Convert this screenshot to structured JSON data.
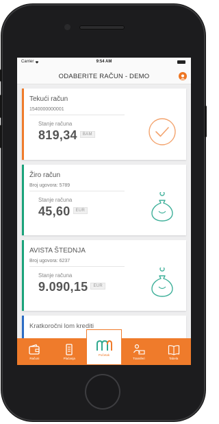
{
  "status_bar": {
    "carrier": "Carrier",
    "time": "9:54 AM"
  },
  "header": {
    "title": "ODABERITE RAČUN - DEMO"
  },
  "accounts": [
    {
      "name": "Tekući račun",
      "subtitle": "1540000000001",
      "balance_label": "Stanje računa",
      "balance": "819,34",
      "currency": "BAM",
      "accent_color": "#ef7b2b",
      "icon": "checkmark-circle-icon",
      "icon_color": "#f3a36d"
    },
    {
      "name": "Žiro račun",
      "subtitle": "Broj ugovora: 5789",
      "balance_label": "Stanje računa",
      "balance": "45,60",
      "currency": "EUR",
      "accent_color": "#1aa37a",
      "icon": "piggy-bank-icon",
      "icon_color": "#3fb09a"
    },
    {
      "name": "AVISTA ŠTEDNJA",
      "subtitle": "Broj ugovora: 6237",
      "balance_label": "Stanje računa",
      "balance": "9.090,15",
      "currency": "EUR",
      "accent_color": "#1aa37a",
      "icon": "piggy-bank-icon",
      "icon_color": "#3fb09a"
    },
    {
      "name": "Kratkoročni lom krediti",
      "accent_color": "#2b6cc4"
    }
  ],
  "tabs": [
    {
      "label": "Računi",
      "icon": "wallet-icon"
    },
    {
      "label": "Plaćanja",
      "icon": "payment-icon"
    },
    {
      "label": "Početak",
      "icon": "home-logo-icon"
    },
    {
      "label": "Transferi",
      "icon": "transfer-icon"
    },
    {
      "label": "Tabela",
      "icon": "book-icon"
    }
  ],
  "colors": {
    "brand": "#ef7b2b",
    "savings": "#1aa37a",
    "credit": "#2b6cc4"
  }
}
